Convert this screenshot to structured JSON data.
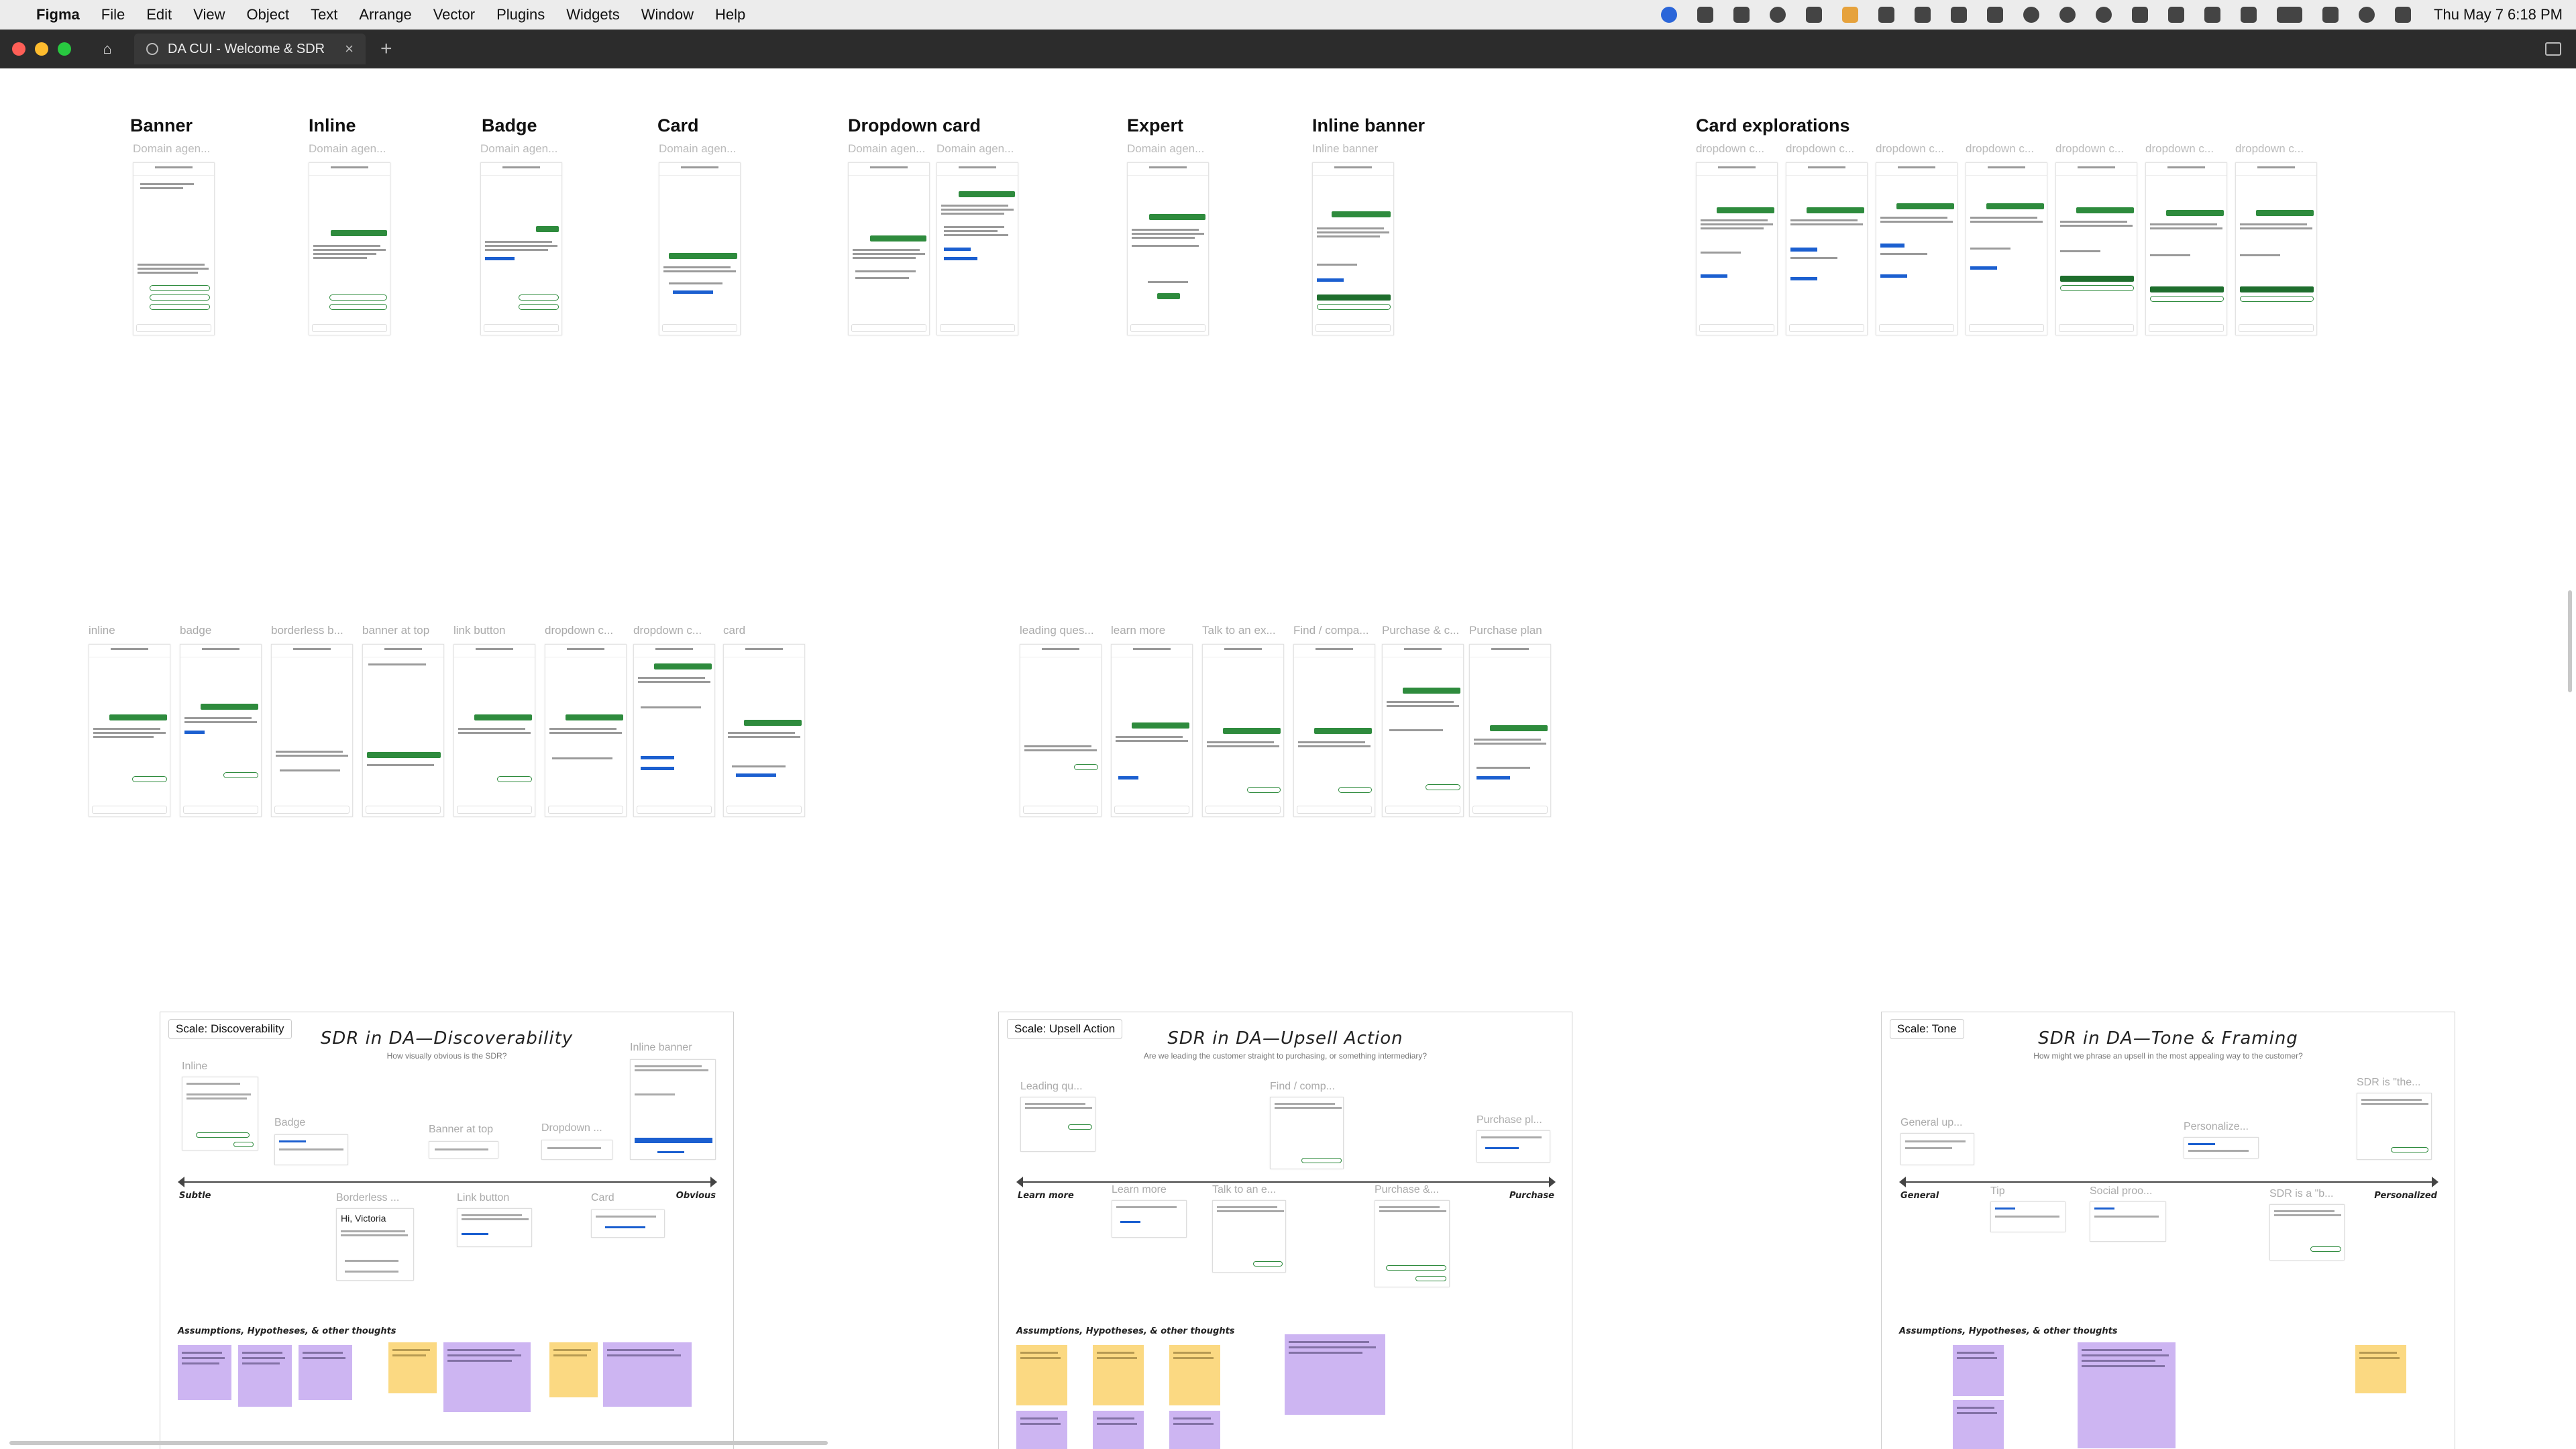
{
  "menubar": {
    "apple": "",
    "app": "Figma",
    "items": [
      "File",
      "Edit",
      "View",
      "Object",
      "Text",
      "Arrange",
      "Vector",
      "Plugins",
      "Widgets",
      "Window",
      "Help"
    ],
    "clock": "Thu May 7  6:18 PM"
  },
  "tabbar": {
    "file_tab": "DA CUI - Welcome & SDR",
    "close": "×",
    "new_tab": "+",
    "home": "⌂"
  },
  "sections": [
    {
      "title": "Banner",
      "sub": "Domain agen..."
    },
    {
      "title": "Inline",
      "sub": "Domain agen..."
    },
    {
      "title": "Badge",
      "sub": "Domain agen..."
    },
    {
      "title": "Card",
      "sub": "Domain agen..."
    },
    {
      "title": "Dropdown card",
      "sub": "Domain agen...",
      "sub2": "Domain agen..."
    },
    {
      "title": "Expert",
      "sub": "Domain agen..."
    },
    {
      "title": "Inline banner",
      "sub": "Inline banner"
    },
    {
      "title": "Card explorations",
      "subs": [
        "dropdown c...",
        "dropdown c...",
        "dropdown c...",
        "dropdown c...",
        "dropdown c...",
        "dropdown c...",
        "dropdown c..."
      ]
    }
  ],
  "row2_labels": [
    "inline",
    "badge",
    "borderless b...",
    "banner at top",
    "link button",
    "dropdown c...",
    "dropdown c...",
    "card"
  ],
  "row3_labels": [
    "leading ques...",
    "learn more",
    "Talk to an ex...",
    "Find / compa...",
    "Purchase & c...",
    "Purchase plan"
  ],
  "boards": [
    {
      "chip": "Scale: Discoverability",
      "title": "SDR in DA—Discoverability",
      "subtitle": "How visually obvious is the SDR?",
      "left_end": "Subtle",
      "right_end": "Obvious",
      "labels": [
        "Inline",
        "Badge",
        "Banner at top",
        "Dropdown ...",
        "Inline banner",
        "Borderless ...",
        "Link button",
        "Card"
      ],
      "greeting": "Hi, Victoria",
      "assumptions": "Assumptions, Hypotheses, & other thoughts"
    },
    {
      "chip": "Scale: Upsell Action",
      "title": "SDR in DA—Upsell Action",
      "subtitle": "Are we leading the customer straight to purchasing, or something intermediary?",
      "left_end": "Learn more",
      "right_end": "Purchase",
      "labels": [
        "Leading qu...",
        "Find / comp...",
        "Purchase pl...",
        "Learn more",
        "Talk to an e...",
        "Purchase &..."
      ],
      "assumptions": "Assumptions, Hypotheses, & other thoughts"
    },
    {
      "chip": "Scale: Tone",
      "title": "SDR in DA—Tone & Framing",
      "subtitle": "How might we phrase an upsell in the most appealing way to the customer?",
      "left_end": "General",
      "right_end": "Personalized",
      "labels": [
        "SDR is \"the...",
        "General up...",
        "Personalize...",
        "Tip",
        "Social proo...",
        "SDR is a \"b..."
      ],
      "assumptions": "Assumptions, Hypotheses, & other thoughts"
    }
  ],
  "colors": {
    "green": "#2e8b3d",
    "blue": "#1b5fd0",
    "sticky_purple": "#cdb5f2",
    "sticky_yellow": "#fbd982"
  }
}
